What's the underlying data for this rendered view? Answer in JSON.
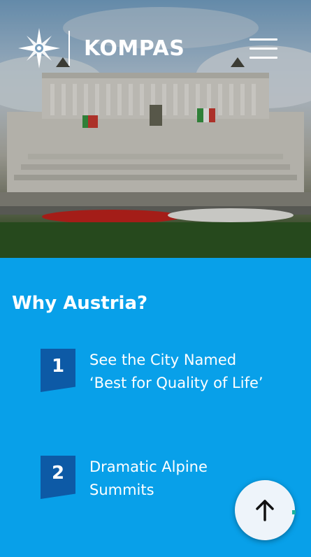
{
  "header": {
    "logo_text": "KOMPAS",
    "menu_icon": "hamburger-icon"
  },
  "hero": {
    "image_subject": "white marble monument with colonnade and flags"
  },
  "section": {
    "title": "Why Austria?",
    "reasons": [
      {
        "number": "1",
        "text": "See the City Named ‘Best for Quality of Life’"
      },
      {
        "number": "2",
        "text": "Dramatic Alpine Summits"
      }
    ]
  },
  "back_to_top": {
    "icon": "arrow-up-icon"
  },
  "colors": {
    "section_bg": "#08a0e9",
    "badge_bg": "#0d5aa6",
    "button_bg": "#eef4fa",
    "text": "#ffffff"
  }
}
